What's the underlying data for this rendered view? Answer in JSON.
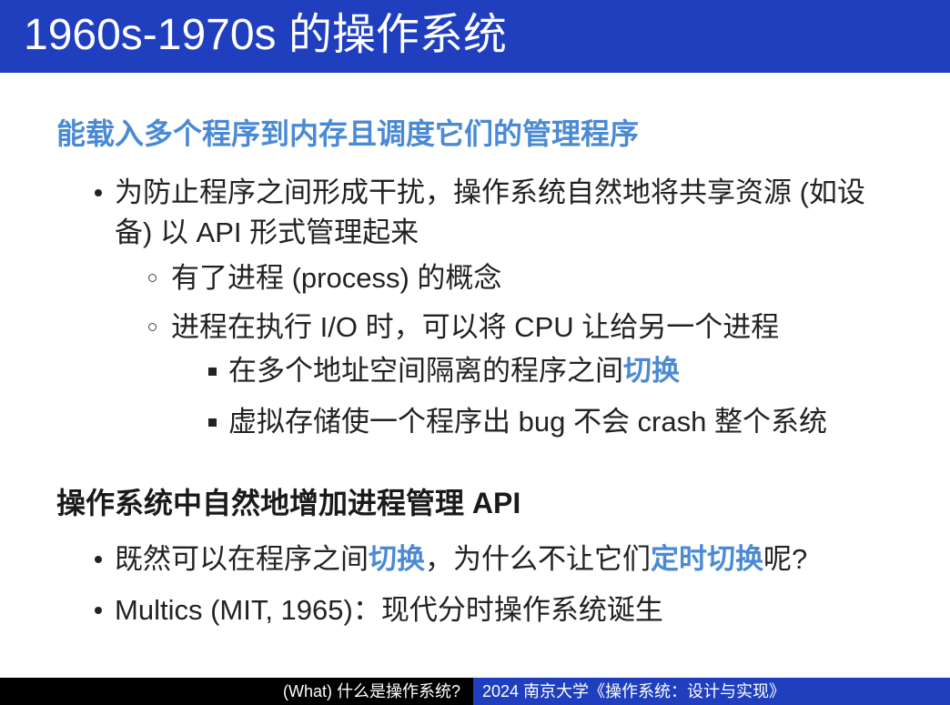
{
  "title": "1960s-1970s 的操作系统",
  "section1": {
    "heading": "能载入多个程序到内存且调度它们的管理程序",
    "bullet1": {
      "line1": "为防止程序之间形成干扰，操作系统自然地将共享资源 (如设",
      "line2": "备) 以 API 形式管理起来"
    },
    "sub1": "有了进程 (process) 的概念",
    "sub2": "进程在执行 I/O 时，可以将 CPU 让给另一个进程",
    "subsub1": {
      "text": "在多个地址空间隔离的程序之间",
      "highlight": "切换"
    },
    "subsub2": "虚拟存储使一个程序出 bug 不会 crash 整个系统"
  },
  "section2": {
    "heading": "操作系统中自然地增加进程管理 API",
    "bullet1": {
      "part1": "既然可以在程序之间",
      "hl1": "切换",
      "part2": "，为什么不让它们",
      "hl2": "定时切换",
      "part3": "呢?"
    },
    "bullet2": "Multics (MIT, 1965)：现代分时操作系统诞生"
  },
  "footer": {
    "left": "(What) 什么是操作系统?",
    "right": "2024 南京大学《操作系统：设计与实现》"
  },
  "colors": {
    "title_bar": "#1f3fbf",
    "highlight": "#4a8ad4",
    "footer_bg": "#000000"
  }
}
